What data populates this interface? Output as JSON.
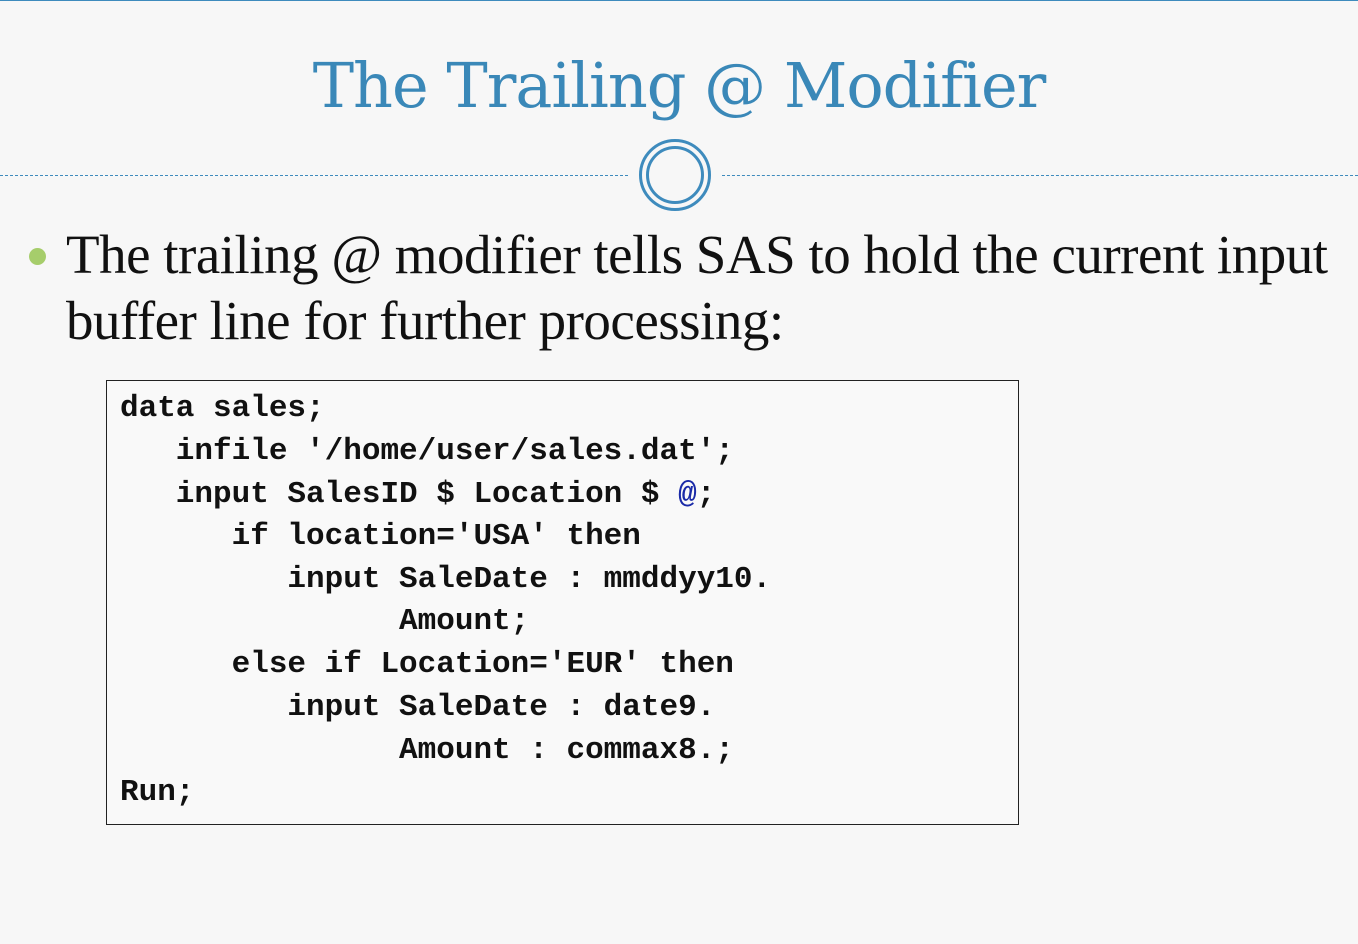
{
  "slide": {
    "title": "The Trailing @ Modifier",
    "bullet": "The trailing @ modifier tells SAS to hold the current input buffer line for further processing:"
  },
  "code": {
    "lines": [
      "data sales;",
      "   infile '/home/user/sales.dat';",
      "   input SalesID $ Location $ ",
      "      if location='USA' then",
      "         input SaleDate : mmddyy10.",
      "               Amount;",
      "      else if Location='EUR' then",
      "         input SaleDate : date9.",
      "               Amount : commax8.;",
      "Run;"
    ],
    "line3_highlight": "@",
    "line3_tail": ";"
  },
  "colors": {
    "title": "#3a88b8",
    "accent_rule": "#3e8bbd",
    "bullet": "#a6cd6b",
    "highlight": "#1a2aa8"
  }
}
